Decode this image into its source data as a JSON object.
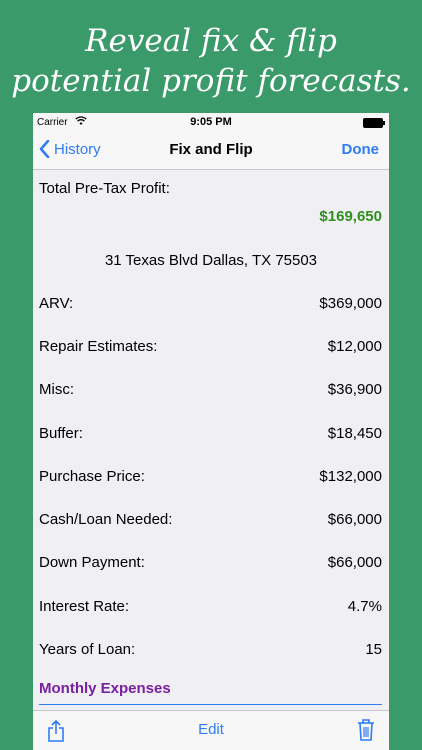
{
  "banner": {
    "line1": "Reveal fix & flip",
    "line2": "potential profit forecasts.",
    "background_color": "#3a9a6a"
  },
  "status_bar": {
    "carrier": "Carrier",
    "wifi_icon": "wifi-icon",
    "time": "9:05 PM",
    "battery_icon": "battery-icon"
  },
  "nav": {
    "back_label": "History",
    "back_icon": "chevron-left-icon",
    "title": "Fix and Flip",
    "done_label": "Done",
    "tint_color": "#2f7cf6"
  },
  "summary": {
    "profit_label": "Total Pre-Tax Profit:",
    "profit_value": "$169,650",
    "profit_color": "#2f8f1e",
    "address": "31 Texas Blvd Dallas, TX 75503"
  },
  "rows": [
    {
      "label": "ARV:",
      "value": "$369,000"
    },
    {
      "label": "Repair Estimates:",
      "value": "$12,000"
    },
    {
      "label": "Misc:",
      "value": "$36,900"
    },
    {
      "label": "Buffer:",
      "value": "$18,450"
    },
    {
      "label": "Purchase Price:",
      "value": "$132,000"
    },
    {
      "label": "Cash/Loan Needed:",
      "value": "$66,000"
    },
    {
      "label": "Down Payment:",
      "value": "$66,000"
    },
    {
      "label": "Interest Rate:",
      "value": "4.7%"
    },
    {
      "label": "Years of Loan:",
      "value": "15"
    }
  ],
  "section": {
    "title": "Monthly Expenses",
    "color": "#7a1fa2"
  },
  "toolbar": {
    "share_icon": "share-icon",
    "edit_label": "Edit",
    "trash_icon": "trash-icon"
  }
}
